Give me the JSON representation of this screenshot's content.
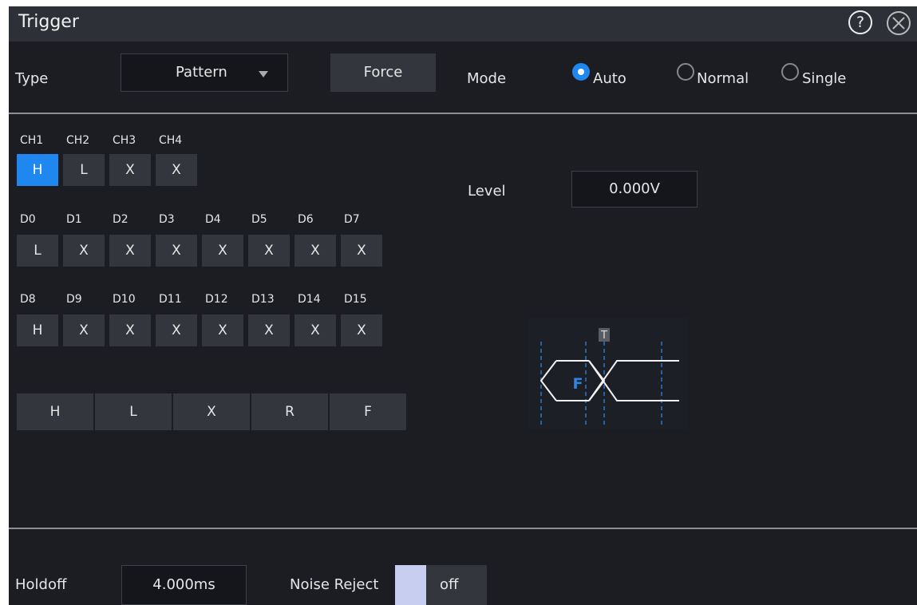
{
  "window": {
    "title": "Trigger"
  },
  "type": {
    "label": "Type",
    "value": "Pattern"
  },
  "force_label": "Force",
  "mode": {
    "label": "Mode",
    "options": [
      "Auto",
      "Normal",
      "Single"
    ],
    "selected": "Auto"
  },
  "channels": {
    "analog": [
      {
        "name": "CH1",
        "value": "H"
      },
      {
        "name": "CH2",
        "value": "L"
      },
      {
        "name": "CH3",
        "value": "X"
      },
      {
        "name": "CH4",
        "value": "X"
      }
    ],
    "digital_low": [
      {
        "name": "D0",
        "value": "L"
      },
      {
        "name": "D1",
        "value": "X"
      },
      {
        "name": "D2",
        "value": "X"
      },
      {
        "name": "D3",
        "value": "X"
      },
      {
        "name": "D4",
        "value": "X"
      },
      {
        "name": "D5",
        "value": "X"
      },
      {
        "name": "D6",
        "value": "X"
      },
      {
        "name": "D7",
        "value": "X"
      }
    ],
    "digital_high": [
      {
        "name": "D8",
        "value": "H"
      },
      {
        "name": "D9",
        "value": "X"
      },
      {
        "name": "D10",
        "value": "X"
      },
      {
        "name": "D11",
        "value": "X"
      },
      {
        "name": "D12",
        "value": "X"
      },
      {
        "name": "D13",
        "value": "X"
      },
      {
        "name": "D14",
        "value": "X"
      },
      {
        "name": "D15",
        "value": "X"
      }
    ]
  },
  "pattern_picker": [
    "H",
    "L",
    "X",
    "R",
    "F"
  ],
  "level": {
    "label": "Level",
    "value": "0.000V"
  },
  "diagram": {
    "trigger_marker": "T",
    "pattern_letter": "F"
  },
  "holdoff": {
    "label": "Holdoff",
    "value": "4.000ms"
  },
  "noise_reject": {
    "label": "Noise Reject",
    "value": "off"
  },
  "colors": {
    "accent": "#1e88f0",
    "background": "#1b1d23",
    "button": "#33363c"
  }
}
